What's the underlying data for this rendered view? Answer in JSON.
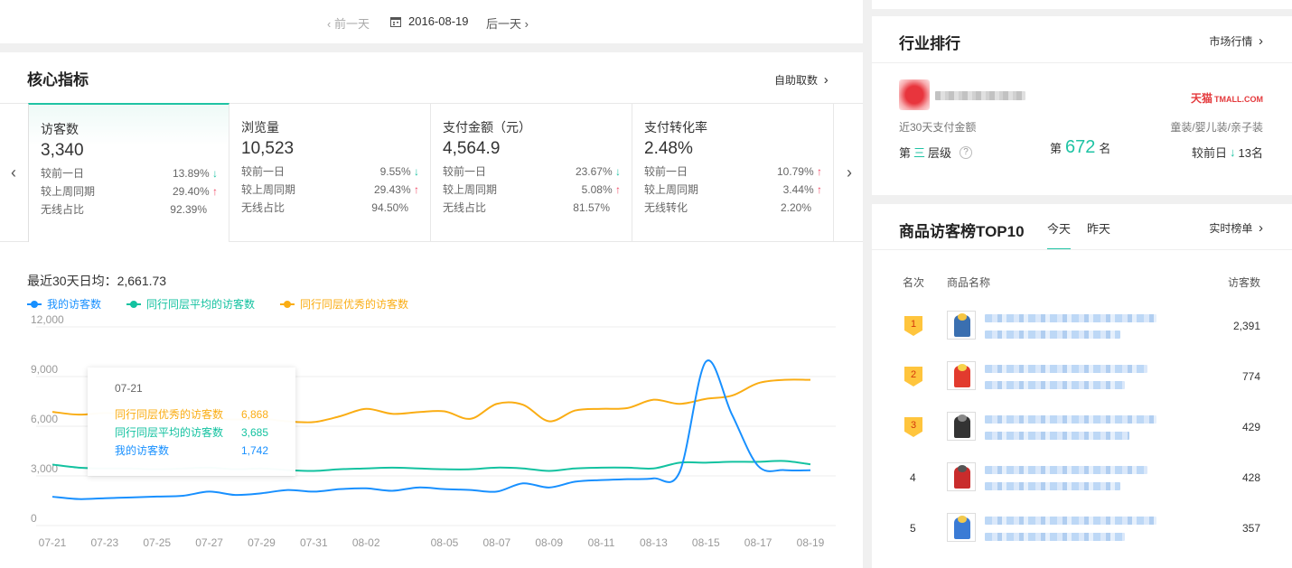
{
  "datebar": {
    "prev": "前一天",
    "current": "2016-08-19",
    "next": "后一天"
  },
  "core": {
    "title": "核心指标",
    "link": "自助取数",
    "cards": [
      {
        "name": "访客数",
        "value": "3,340",
        "rows": [
          {
            "label": "较前一日",
            "value": "13.89%",
            "trend": "down"
          },
          {
            "label": "较上周同期",
            "value": "29.40%",
            "trend": "up"
          },
          {
            "label": "无线占比",
            "value": "92.39%",
            "trend": ""
          }
        ]
      },
      {
        "name": "浏览量",
        "value": "10,523",
        "rows": [
          {
            "label": "较前一日",
            "value": "9.55%",
            "trend": "down"
          },
          {
            "label": "较上周同期",
            "value": "29.43%",
            "trend": "up"
          },
          {
            "label": "无线占比",
            "value": "94.50%",
            "trend": ""
          }
        ]
      },
      {
        "name": "支付金额（元）",
        "value": "4,564.9",
        "rows": [
          {
            "label": "较前一日",
            "value": "23.67%",
            "trend": "down"
          },
          {
            "label": "较上周同期",
            "value": "5.08%",
            "trend": "up"
          },
          {
            "label": "无线占比",
            "value": "81.57%",
            "trend": ""
          }
        ]
      },
      {
        "name": "支付转化率",
        "value": "2.48%",
        "rows": [
          {
            "label": "较前一日",
            "value": "10.79%",
            "trend": "up"
          },
          {
            "label": "较上周同期",
            "value": "3.44%",
            "trend": "up"
          },
          {
            "label": "无线转化",
            "value": "2.20%",
            "trend": ""
          }
        ]
      }
    ],
    "avg_label": "最近30天日均：2,661.73"
  },
  "colors": {
    "accent": "#1fc3a4",
    "mine": "#1890ff",
    "peer_avg": "#13c2a0",
    "peer_top": "#faad14",
    "up": "#f04864"
  },
  "chart_data": {
    "type": "line",
    "x": [
      "07-21",
      "07-22",
      "07-23",
      "07-24",
      "07-25",
      "07-26",
      "07-27",
      "07-28",
      "07-29",
      "07-30",
      "07-31",
      "08-01",
      "08-02",
      "08-03",
      "08-04",
      "08-05",
      "08-06",
      "08-07",
      "08-08",
      "08-09",
      "08-10",
      "08-11",
      "08-12",
      "08-13",
      "08-14",
      "08-15",
      "08-16",
      "08-17",
      "08-18",
      "08-19"
    ],
    "xticks": [
      "07-21",
      "07-23",
      "07-25",
      "07-27",
      "07-29",
      "07-31",
      "08-02",
      "08-05",
      "08-07",
      "08-09",
      "08-11",
      "08-13",
      "08-15",
      "08-17",
      "08-19"
    ],
    "ylim": [
      0,
      12000
    ],
    "yticks": [
      "0",
      "3,000",
      "6,000",
      "9,000",
      "12,000"
    ],
    "yvals": [
      0,
      3000,
      6000,
      9000,
      12000
    ],
    "series": [
      {
        "name": "我的访客数",
        "values": [
          1742,
          1600,
          1650,
          1700,
          1750,
          1800,
          2050,
          1850,
          1950,
          2150,
          2050,
          2200,
          2250,
          2100,
          2300,
          2200,
          2150,
          2050,
          2550,
          2300,
          2650,
          2750,
          2800,
          2850,
          3250,
          9900,
          6700,
          3600,
          3350,
          3340
        ]
      },
      {
        "name": "同行同层平均的访客数",
        "values": [
          3685,
          3500,
          3450,
          3450,
          3400,
          3450,
          3500,
          3400,
          3450,
          3350,
          3300,
          3400,
          3450,
          3500,
          3450,
          3400,
          3400,
          3500,
          3450,
          3300,
          3450,
          3500,
          3500,
          3450,
          3800,
          3800,
          3850,
          3850,
          3900,
          3700
        ]
      },
      {
        "name": "同行同层优秀的访客数",
        "values": [
          6868,
          6700,
          6800,
          6750,
          6800,
          6700,
          6500,
          6400,
          6450,
          6300,
          6250,
          6600,
          7050,
          6750,
          6850,
          6900,
          6450,
          7350,
          7300,
          6300,
          6950,
          7050,
          7100,
          7600,
          7350,
          7650,
          7850,
          8600,
          8800,
          8800
        ]
      }
    ]
  },
  "tooltip": {
    "date": "07-21",
    "rows": [
      {
        "label": "同行同层优秀的访客数",
        "value": "6,868"
      },
      {
        "label": "同行同层平均的访客数",
        "value": "3,685"
      },
      {
        "label": "我的访客数",
        "value": "1,742"
      }
    ]
  },
  "industry": {
    "title": "行业排行",
    "link": "市场行情",
    "brand": "天猫",
    "brand_suffix": "TMALL.COM",
    "metric_label": "近30天支付金额",
    "category": "童装/婴儿装/亲子装",
    "tier_prefix": "第",
    "tier": "三",
    "tier_suffix": "层级",
    "help": "?",
    "rank_prefix": "第",
    "rank": "672",
    "rank_suffix": "名",
    "compare_label": "较前日",
    "compare_value": "13名"
  },
  "top10": {
    "title": "商品访客榜TOP10",
    "tabs": [
      "今天",
      "昨天"
    ],
    "link": "实时榜单",
    "headers": {
      "rank": "名次",
      "name": "商品名称",
      "visitors": "访客数"
    },
    "items": [
      {
        "rank": "1",
        "visitors": "2,391"
      },
      {
        "rank": "2",
        "visitors": "774"
      },
      {
        "rank": "3",
        "visitors": "429"
      },
      {
        "rank": "4",
        "visitors": "428"
      },
      {
        "rank": "5",
        "visitors": "357"
      }
    ]
  }
}
